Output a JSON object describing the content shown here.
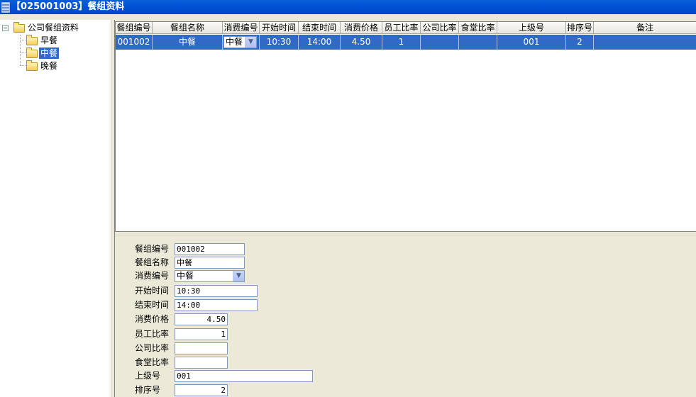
{
  "window": {
    "title": "【025001003】餐组资料"
  },
  "tree": {
    "root": "公司餐组资料",
    "children": [
      "早餐",
      "中餐",
      "晚餐"
    ],
    "selected_index": 1
  },
  "grid": {
    "columns": [
      "餐组编号",
      "餐组名称",
      "消费编号",
      "开始时间",
      "结束时间",
      "消费价格",
      "员工比率",
      "公司比率",
      "食堂比率",
      "上级号",
      "排序号",
      "备注"
    ],
    "rows": [
      {
        "group_no": "001002",
        "group_name": "中餐",
        "consume_no": "中餐",
        "start": "10:30",
        "end": "14:00",
        "price": "4.50",
        "staff_ratio": "1",
        "company_ratio": "",
        "canteen_ratio": "",
        "parent_no": "001",
        "sort_no": "2",
        "remark": ""
      }
    ]
  },
  "form": {
    "group_no": {
      "label": "餐组编号",
      "value": "001002"
    },
    "group_name": {
      "label": "餐组名称",
      "value": "中餐"
    },
    "consume_no": {
      "label": "消费编号",
      "value": "中餐"
    },
    "start_time": {
      "label": "开始时间",
      "value": "10:30"
    },
    "end_time": {
      "label": "结束时间",
      "value": "14:00"
    },
    "price": {
      "label": "消费价格",
      "value": "4.50"
    },
    "staff_ratio": {
      "label": "员工比率",
      "value": "1"
    },
    "company_ratio": {
      "label": "公司比率",
      "value": ""
    },
    "canteen_ratio": {
      "label": "食堂比率",
      "value": ""
    },
    "parent_no": {
      "label": "上级号",
      "value": "001"
    },
    "sort_no": {
      "label": "排序号",
      "value": "2"
    }
  },
  "icons": {
    "tree_folder": "folder-icon",
    "dropdown": "chevron-down-icon"
  }
}
